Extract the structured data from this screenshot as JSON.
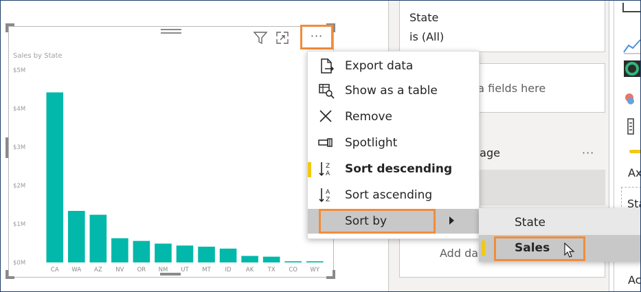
{
  "visual": {
    "chart_title": "Sales by State",
    "more_options": "···"
  },
  "chart_data": {
    "type": "bar",
    "title": "Sales by State",
    "categories": [
      "CA",
      "WA",
      "AZ",
      "NV",
      "OR",
      "NM",
      "UT",
      "MT",
      "ID",
      "AK",
      "TX",
      "CO",
      "WY"
    ],
    "values": [
      4.42,
      1.34,
      1.24,
      0.63,
      0.56,
      0.49,
      0.44,
      0.41,
      0.36,
      0.17,
      0.15,
      0.03,
      0.03
    ],
    "ylim": [
      0,
      5
    ],
    "yticks": [
      "$0M",
      "$1M",
      "$2M",
      "$3M",
      "$4M",
      "$5M"
    ],
    "bar_color": "#01b8aa",
    "grid": false
  },
  "context_menu": {
    "items": [
      {
        "label": "Export data",
        "icon": "export-data-icon"
      },
      {
        "label": "Show as a table",
        "icon": "show-table-icon"
      },
      {
        "label": "Remove",
        "icon": "close-icon"
      },
      {
        "label": "Spotlight",
        "icon": "spotlight-icon"
      },
      {
        "label": "Sort descending",
        "icon": "sort-descending-icon"
      },
      {
        "label": "Sort ascending",
        "icon": "sort-ascending-icon"
      },
      {
        "label": "Sort by",
        "icon": "chevron-right-icon"
      }
    ]
  },
  "submenu": {
    "items": [
      {
        "label": "State"
      },
      {
        "label": "Sales"
      }
    ]
  },
  "filters_pane": {
    "filter_card_title": "State",
    "filter_card_value": "is (All)",
    "drop_hint": "ta fields here",
    "page_section": "page",
    "section_more": "···",
    "add_data": "Add da"
  },
  "viz_pane": {
    "axis_label": "Ax",
    "field_label": "Sta",
    "add_label": "Ac"
  },
  "colors": {
    "accent_orange": "#f18c3a",
    "accent_yellow": "#f2c811",
    "bar_teal": "#01b8aa"
  }
}
